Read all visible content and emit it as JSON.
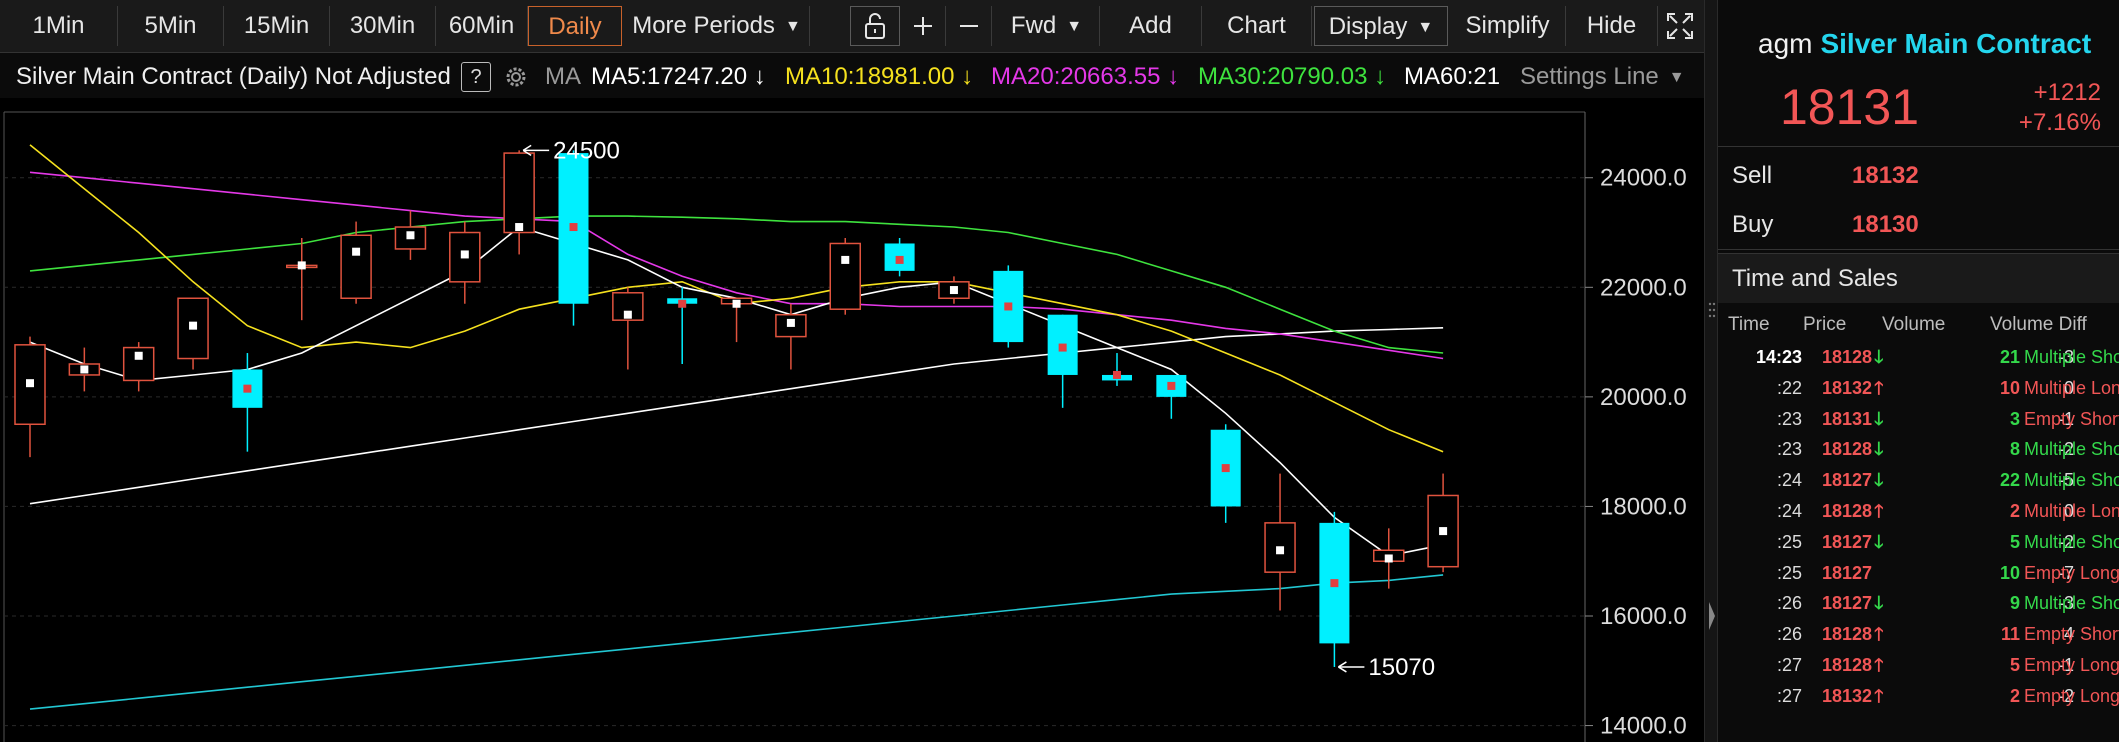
{
  "toolbar": {
    "periods": [
      "1Min",
      "5Min",
      "15Min",
      "30Min",
      "60Min",
      "Daily"
    ],
    "active_period": "Daily",
    "more_periods": "More Periods",
    "fwd": "Fwd",
    "add": "Add",
    "chart": "Chart",
    "display": "Display",
    "simplify": "Simplify",
    "hide": "Hide"
  },
  "infobar": {
    "title": "Silver Main Contract (Daily) Not Adjusted",
    "help": "?",
    "ma_label": "MA",
    "ma5": "MA5:17247.20 ↓",
    "ma10": "MA10:18981.00 ↓",
    "ma20": "MA20:20663.55 ↓",
    "ma30": "MA30:20790.03 ↓",
    "ma60": "MA60:21",
    "settings": "Settings Line",
    "colors": {
      "ma5": "#ffffff",
      "ma10": "#f5e11e",
      "ma20": "#e438e8",
      "ma30": "#3ee23e",
      "ma60": "#ffffff",
      "ma120": "#22c7d2"
    }
  },
  "chart_data": {
    "type": "candlestick",
    "ylim": [
      13700,
      25200
    ],
    "yticks": [
      "24000.0",
      "22000.0",
      "20000.0",
      "18000.0",
      "16000.0",
      "14000.0"
    ],
    "high_label": "24500",
    "low_label": "15070",
    "candles": [
      {
        "o": 19500,
        "h": 21100,
        "l": 18900,
        "c": 20950,
        "cur": 20250
      },
      {
        "o": 20400,
        "h": 20900,
        "l": 20100,
        "c": 20600,
        "cur": 20500
      },
      {
        "o": 20300,
        "h": 21000,
        "l": 20100,
        "c": 20900,
        "cur": 20750
      },
      {
        "o": 20700,
        "h": 21800,
        "l": 20500,
        "c": 21800,
        "cur": 21300
      },
      {
        "o": 20500,
        "h": 20800,
        "l": 19000,
        "c": 19800,
        "cur": 20150
      },
      {
        "o": 22400,
        "h": 22900,
        "l": 21400,
        "c": 22400,
        "cur": 22400
      },
      {
        "o": 21800,
        "h": 23200,
        "l": 21700,
        "c": 22950,
        "cur": 22650
      },
      {
        "o": 22700,
        "h": 23400,
        "l": 22500,
        "c": 23100,
        "cur": 22950
      },
      {
        "o": 22100,
        "h": 23200,
        "l": 21700,
        "c": 23000,
        "cur": 22600
      },
      {
        "o": 23000,
        "h": 24500,
        "l": 22600,
        "c": 24450,
        "cur": 23100
      },
      {
        "o": 24450,
        "h": 24500,
        "l": 21300,
        "c": 21700,
        "cur": 23100
      },
      {
        "o": 21400,
        "h": 22000,
        "l": 20500,
        "c": 21900,
        "cur": 21500
      },
      {
        "o": 21800,
        "h": 22000,
        "l": 20600,
        "c": 21700,
        "cur": 21700
      },
      {
        "o": 21700,
        "h": 21800,
        "l": 21000,
        "c": 21800,
        "cur": 21700
      },
      {
        "o": 21100,
        "h": 21700,
        "l": 20500,
        "c": 21500,
        "cur": 21350
      },
      {
        "o": 21600,
        "h": 22900,
        "l": 21500,
        "c": 22800,
        "cur": 22500
      },
      {
        "o": 22800,
        "h": 22900,
        "l": 22200,
        "c": 22300,
        "cur": 22500
      },
      {
        "o": 21800,
        "h": 22200,
        "l": 21700,
        "c": 22100,
        "cur": 21950
      },
      {
        "o": 22300,
        "h": 22400,
        "l": 20900,
        "c": 21000,
        "cur": 21650
      },
      {
        "o": 21500,
        "h": 21500,
        "l": 19800,
        "c": 20400,
        "cur": 20900
      },
      {
        "o": 20400,
        "h": 20800,
        "l": 20200,
        "c": 20300,
        "cur": 20400
      },
      {
        "o": 20400,
        "h": 20400,
        "l": 19600,
        "c": 20000,
        "cur": 20200
      },
      {
        "o": 19400,
        "h": 19500,
        "l": 17700,
        "c": 18000,
        "cur": 18700
      },
      {
        "o": 16800,
        "h": 18600,
        "l": 16100,
        "c": 17700,
        "cur": 17200
      },
      {
        "o": 17700,
        "h": 17900,
        "l": 15070,
        "c": 15500,
        "cur": 16600
      },
      {
        "o": 17000,
        "h": 17600,
        "l": 16500,
        "c": 17200,
        "cur": 17050
      },
      {
        "o": 16900,
        "h": 18600,
        "l": 16800,
        "c": 18200,
        "cur": 17550
      }
    ],
    "ma5": [
      21000,
      20600,
      20300,
      20400,
      20500,
      20800,
      21300,
      21800,
      22300,
      23100,
      22800,
      22500,
      22000,
      21800,
      21500,
      21800,
      22000,
      22100,
      21700,
      21300,
      20900,
      20500,
      19700,
      18800,
      17800,
      17100,
      17300
    ],
    "ma10": [
      24600,
      23800,
      23000,
      22100,
      21300,
      20900,
      21000,
      20900,
      21200,
      21600,
      21800,
      22000,
      22100,
      21700,
      21800,
      22000,
      22100,
      22100,
      21900,
      21700,
      21500,
      21200,
      20800,
      20400,
      19900,
      19400,
      19000
    ],
    "ma20": [
      24100,
      24000,
      23900,
      23800,
      23700,
      23600,
      23500,
      23400,
      23300,
      23250,
      23200,
      22600,
      22200,
      21900,
      21700,
      21700,
      21650,
      21650,
      21650,
      21600,
      21500,
      21400,
      21250,
      21150,
      21000,
      20850,
      20700
    ],
    "ma30": [
      22300,
      22400,
      22500,
      22600,
      22700,
      22800,
      23000,
      23100,
      23200,
      23250,
      23300,
      23300,
      23280,
      23250,
      23200,
      23200,
      23150,
      23100,
      23000,
      22800,
      22600,
      22300,
      22000,
      21600,
      21200,
      20900,
      20800
    ],
    "ma60": [
      18050,
      18200,
      18350,
      18500,
      18650,
      18800,
      18950,
      19100,
      19250,
      19400,
      19550,
      19700,
      19850,
      20000,
      20150,
      20300,
      20450,
      20600,
      20700,
      20800,
      20900,
      21000,
      21100,
      21150,
      21200,
      21230,
      21260
    ],
    "ma120": [
      14300,
      14400,
      14500,
      14600,
      14700,
      14800,
      14900,
      15000,
      15100,
      15200,
      15300,
      15400,
      15500,
      15600,
      15700,
      15800,
      15900,
      16000,
      16100,
      16200,
      16300,
      16400,
      16450,
      16500,
      16600,
      16650,
      16750
    ]
  },
  "quote": {
    "prefix": "agm",
    "name": "Silver Main Contract",
    "last": "18131",
    "change": "+1212",
    "change_pct": "+7.16%",
    "sell_label": "Sell",
    "sell": "18132",
    "buy_label": "Buy",
    "buy": "18130"
  },
  "time_sales": {
    "title": "Time and Sales",
    "headers": [
      "Time",
      "Price",
      "Volume",
      "Volume Diff"
    ],
    "rows": [
      {
        "time": "14:23",
        "price": "18128",
        "dir": "dn",
        "vol": "21",
        "diff": "-3",
        "type": "Multiple Short",
        "tc": "green"
      },
      {
        "time": ":22",
        "price": "18132",
        "dir": "up",
        "vol": "10",
        "diff": "0",
        "type": "Multiple Long",
        "tc": "red"
      },
      {
        "time": ":23",
        "price": "18131",
        "dir": "dn",
        "vol": "3",
        "diff": "-1",
        "type": "Empty Short",
        "tc": "red"
      },
      {
        "time": ":23",
        "price": "18128",
        "dir": "dn",
        "vol": "8",
        "diff": "-2",
        "type": "Multiple Short",
        "tc": "green"
      },
      {
        "time": ":24",
        "price": "18127",
        "dir": "dn",
        "vol": "22",
        "diff": "-5",
        "type": "Multiple Short",
        "tc": "green"
      },
      {
        "time": ":24",
        "price": "18128",
        "dir": "up",
        "vol": "2",
        "diff": "0",
        "type": "Multiple Long",
        "tc": "red"
      },
      {
        "time": ":25",
        "price": "18127",
        "dir": "dn",
        "vol": "5",
        "diff": "-2",
        "type": "Multiple Short",
        "tc": "green"
      },
      {
        "time": ":25",
        "price": "18127",
        "dir": "",
        "vol": "10",
        "diff": "-7",
        "type": "Empty Long",
        "tc": "red"
      },
      {
        "time": ":26",
        "price": "18127",
        "dir": "dn",
        "vol": "9",
        "diff": "-3",
        "type": "Multiple Short",
        "tc": "green"
      },
      {
        "time": ":26",
        "price": "18128",
        "dir": "up",
        "vol": "11",
        "diff": "4",
        "type": "Empty Short",
        "tc": "red"
      },
      {
        "time": ":27",
        "price": "18128",
        "dir": "up",
        "vol": "5",
        "diff": "-1",
        "type": "Empty Long",
        "tc": "red"
      },
      {
        "time": ":27",
        "price": "18132",
        "dir": "up",
        "vol": "2",
        "diff": "-2",
        "type": "Empty Long",
        "tc": "red"
      }
    ]
  }
}
